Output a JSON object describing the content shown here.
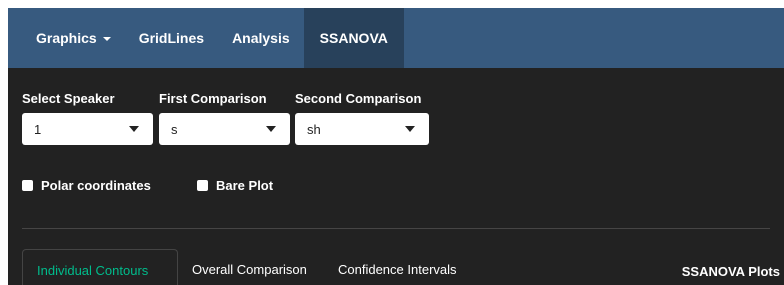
{
  "navbar": {
    "items": [
      {
        "label": "Graphics",
        "has_caret": true
      },
      {
        "label": "GridLines"
      },
      {
        "label": "Analysis"
      },
      {
        "label": "SSANOVA",
        "active": true
      }
    ]
  },
  "controls": {
    "speaker": {
      "label": "Select Speaker",
      "value": "1"
    },
    "first": {
      "label": "First Comparison",
      "value": "s"
    },
    "second": {
      "label": "Second Comparison",
      "value": "sh"
    }
  },
  "checkboxes": {
    "polar": {
      "label": "Polar coordinates",
      "checked": false
    },
    "bare": {
      "label": "Bare Plot",
      "checked": false
    }
  },
  "tabs": [
    {
      "label": "Individual Contours",
      "active": true
    },
    {
      "label": "Overall Comparison"
    },
    {
      "label": "Confidence Intervals"
    }
  ],
  "plots_title": "SSANOVA Plots",
  "colors": {
    "navbar_bg": "#375a7f",
    "navbar_active_bg": "#28415b",
    "body_bg": "#222222",
    "accent": "#00bc8c"
  }
}
